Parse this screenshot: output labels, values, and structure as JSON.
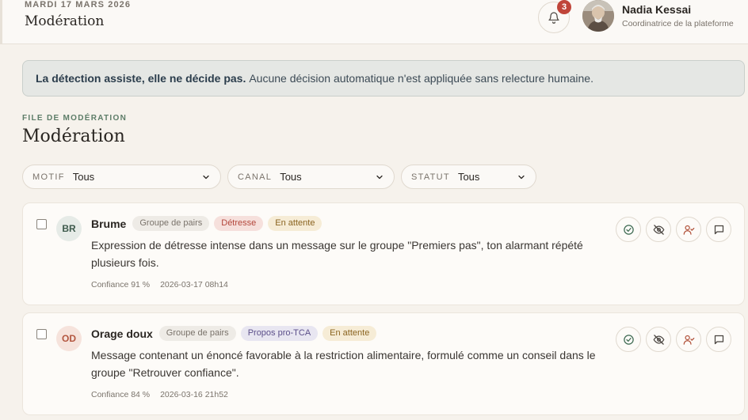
{
  "header": {
    "date": "MARDI 17 MARS 2026",
    "title": "Modération",
    "notifications_count": "3",
    "user": {
      "name": "Nadia Kessai",
      "role": "Coordinatrice de la plateforme"
    }
  },
  "notice": {
    "bold": "La détection assiste, elle ne décide pas.",
    "text": "Aucune décision automatique n'est appliquée sans relecture humaine."
  },
  "page": {
    "eyebrow": "FILE DE MODÉRATION",
    "title": "Modération"
  },
  "filters": [
    {
      "label": "MOTIF",
      "value": "Tous"
    },
    {
      "label": "CANAL",
      "value": "Tous"
    },
    {
      "label": "STATUT",
      "value": "Tous"
    }
  ],
  "items": [
    {
      "initials": "BR",
      "name": "Brume",
      "tags": [
        "Groupe de pairs",
        "Détresse",
        "En attente"
      ],
      "text": "Expression de détresse intense dans un message sur le groupe \"Premiers pas\", ton alarmant répété plusieurs fois.",
      "confidence": "Confiance 91 %",
      "timestamp": "2026-03-17 08h14"
    },
    {
      "initials": "OD",
      "name": "Orage doux",
      "tags": [
        "Groupe de pairs",
        "Propos pro-TCA",
        "En attente"
      ],
      "text": "Message contenant un énoncé favorable à la restriction alimentaire, formulé comme un conseil dans le groupe \"Retrouver confiance\".",
      "confidence": "Confiance 84 %",
      "timestamp": "2026-03-16 21h52"
    }
  ],
  "icons": {
    "bell": "bell-icon",
    "chevron": "chevron-down-icon",
    "approve": "check-circle-icon",
    "hide": "eye-off-icon",
    "assign": "user-check-icon",
    "comment": "message-icon"
  },
  "colors": {
    "accent": "#5d7d68",
    "badge": "#c0453a",
    "notice_bg": "#e5e7e4"
  }
}
